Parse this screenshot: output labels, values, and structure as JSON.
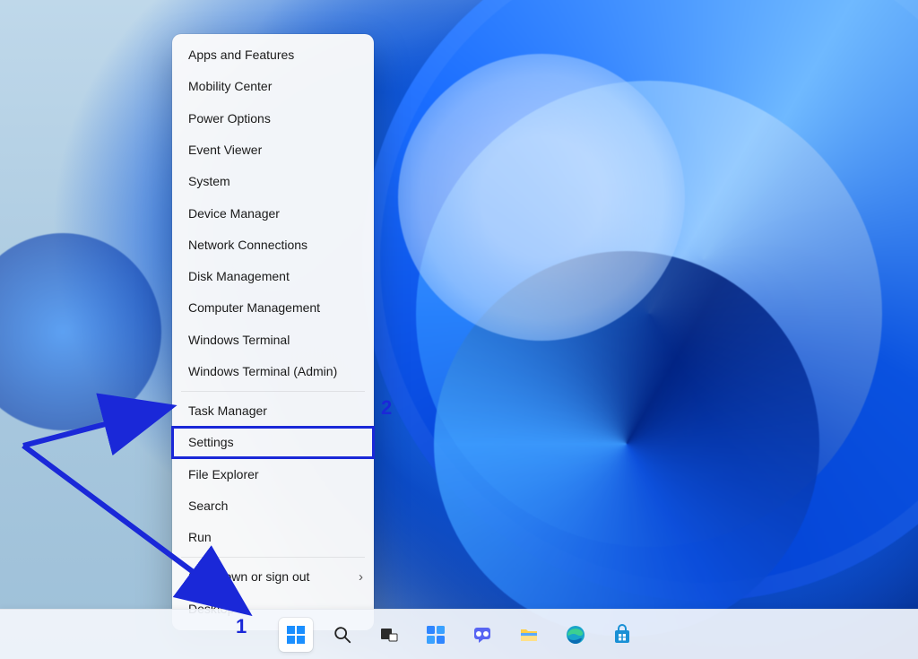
{
  "annotations": {
    "num1": "1",
    "num2": "2"
  },
  "menu": {
    "items": [
      {
        "label": "Apps and Features"
      },
      {
        "label": "Mobility Center"
      },
      {
        "label": "Power Options"
      },
      {
        "label": "Event Viewer"
      },
      {
        "label": "System"
      },
      {
        "label": "Device Manager"
      },
      {
        "label": "Network Connections"
      },
      {
        "label": "Disk Management"
      },
      {
        "label": "Computer Management"
      },
      {
        "label": "Windows Terminal"
      },
      {
        "label": "Windows Terminal (Admin)"
      },
      {
        "label": "Task Manager"
      },
      {
        "label": "Settings"
      },
      {
        "label": "File Explorer"
      },
      {
        "label": "Search"
      },
      {
        "label": "Run"
      },
      {
        "label": "Shut down or sign out"
      },
      {
        "label": "Desktop"
      }
    ]
  },
  "taskbar": {
    "icons": [
      "start",
      "search",
      "taskview",
      "widgets",
      "chat",
      "explorer",
      "edge",
      "store"
    ]
  }
}
